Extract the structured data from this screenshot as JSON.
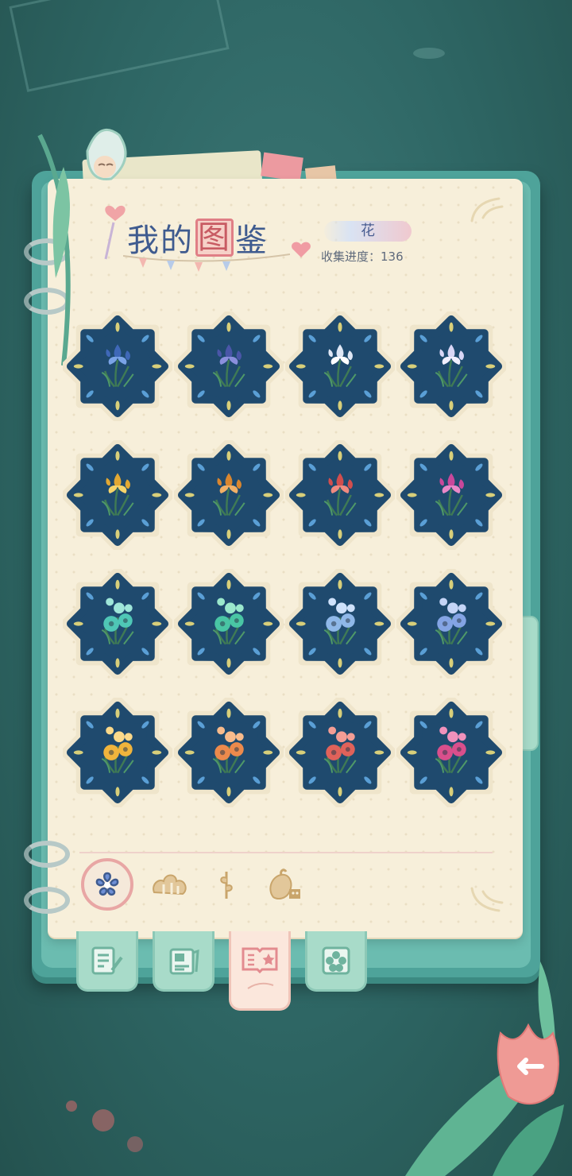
{
  "header": {
    "title_part1": "我的",
    "title_highlight": "图",
    "title_part2": "鉴",
    "category": "花",
    "progress_label": "收集进度：",
    "progress_value": "136"
  },
  "flowers": [
    {
      "type": "iris",
      "color": "#3f68b8",
      "accent": "#7aa3e6"
    },
    {
      "type": "iris",
      "color": "#4a56a8",
      "accent": "#8a8fdc"
    },
    {
      "type": "iris",
      "color": "#dfe7f5",
      "accent": "#ffffff"
    },
    {
      "type": "iris",
      "color": "#d9d6f5",
      "accent": "#f2efff"
    },
    {
      "type": "iris",
      "color": "#e2a833",
      "accent": "#f6d46a"
    },
    {
      "type": "iris",
      "color": "#d9862f",
      "accent": "#f2b067"
    },
    {
      "type": "iris",
      "color": "#d24e4e",
      "accent": "#f08a80"
    },
    {
      "type": "iris",
      "color": "#c9489b",
      "accent": "#ea88c8"
    },
    {
      "type": "pansy",
      "color": "#4fc7b6",
      "accent": "#9fe6d9"
    },
    {
      "type": "pansy",
      "color": "#49c5a4",
      "accent": "#9be8cc"
    },
    {
      "type": "pansy",
      "color": "#8fb8e8",
      "accent": "#cfe2fb"
    },
    {
      "type": "pansy",
      "color": "#84a4e4",
      "accent": "#c5d5f7"
    },
    {
      "type": "pansy",
      "color": "#f0b43c",
      "accent": "#fbd98a"
    },
    {
      "type": "pansy",
      "color": "#ec8a4c",
      "accent": "#f8bb8c"
    },
    {
      "type": "pansy",
      "color": "#e0625a",
      "accent": "#f49d95"
    },
    {
      "type": "pansy",
      "color": "#d94f8c",
      "accent": "#f192bc"
    }
  ],
  "filters": [
    {
      "name": "flower-filter",
      "icon": "flower-icon",
      "active": true
    },
    {
      "name": "bush-filter",
      "icon": "bush-icon",
      "active": false
    },
    {
      "name": "herb-filter",
      "icon": "herb-icon",
      "active": false
    },
    {
      "name": "produce-filter",
      "icon": "produce-icon",
      "active": false
    }
  ],
  "tabs": [
    {
      "name": "notes",
      "icon": "notes-icon",
      "active": false
    },
    {
      "name": "album",
      "icon": "album-icon",
      "active": false
    },
    {
      "name": "collection",
      "icon": "collection-book-icon",
      "active": true
    },
    {
      "name": "garden",
      "icon": "flower-badge-icon",
      "active": false
    }
  ],
  "colors": {
    "badge_bg": "#1f4a6e",
    "badge_ring": "#efe5cb",
    "page": "#f7efda",
    "title": "#3f5b8f",
    "highlight_border": "#e07f86"
  }
}
